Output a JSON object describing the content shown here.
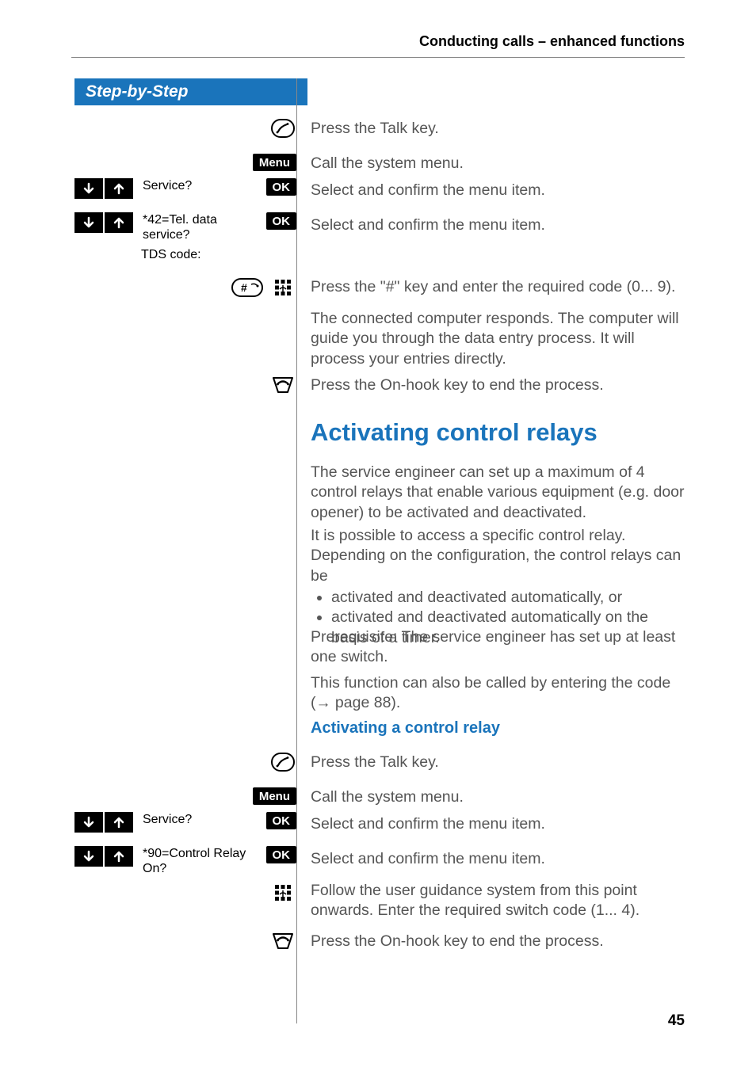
{
  "header": {
    "running_head": "Conducting calls – enhanced functions"
  },
  "sidebar": {
    "title": "Step-by-Step"
  },
  "buttons": {
    "menu": "Menu",
    "ok": "OK"
  },
  "left": {
    "service": "Service?",
    "tel_data_service": "*42=Tel. data service?",
    "tds_code": "TDS code:",
    "control_relay_on": "*90=Control Relay On?"
  },
  "right": {
    "talk1": "Press the Talk key.",
    "callmenu1": "Call the system menu.",
    "select1": "Select and confirm the menu item.",
    "select2": "Select and confirm the menu item.",
    "hash_code": "Press the \"#\" key and enter the required code (0... 9).",
    "computer_response": "The connected computer responds. The computer will guide you through the data entry process. It will process your entries directly.",
    "onhook1": "Press the On-hook key to end the process.",
    "h2_activating": "Activating control relays",
    "para_relays": "The service engineer can set up a maximum of 4 control relays that enable various equipment (e.g. door opener) to be activated and deactivated.",
    "para_access": "It is possible to access a specific control relay. Depending on the configuration, the control relays can be",
    "bullets": [
      "activated and deactivated automatically, or",
      "activated and deactivated automatically on the basis of a timer."
    ],
    "prereq": "Prerequisite: The service engineer has set up at least one switch.",
    "also_code_prefix": "This function can also be called by entering the code (",
    "page_ref": "page 88",
    "also_code_suffix": ").",
    "h4_activating_relay": "Activating a control relay",
    "talk2": "Press the Talk key.",
    "callmenu2": "Call the system menu.",
    "select3": "Select and confirm the menu item.",
    "select4": "Select and confirm the menu item.",
    "follow_guidance": "Follow the user guidance system from this point onwards. Enter the required switch code (1... 4).",
    "onhook2": "Press the On-hook key to end the process."
  },
  "page_number": "45"
}
